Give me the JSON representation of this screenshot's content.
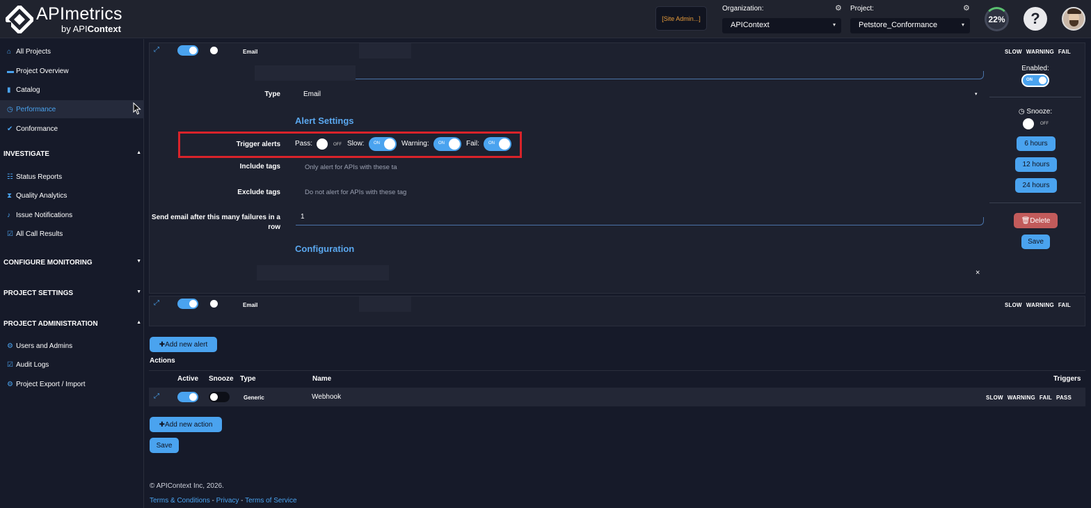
{
  "header": {
    "brand": "APImetrics",
    "brand_sub_prefix": "by API",
    "brand_sub_suffix": "Context",
    "site_admin": "[Site Admin...]",
    "org_label": "Organization:",
    "org_value": "APIContext",
    "project_label": "Project:",
    "project_value": "Petstore_Conformance",
    "progress_percent": "22%",
    "help": "?"
  },
  "sidebar": {
    "items": [
      {
        "label": "All Projects",
        "icon": "home-icon"
      },
      {
        "label": "Project Overview",
        "icon": "folder-icon"
      },
      {
        "label": "Catalog",
        "icon": "book-icon"
      },
      {
        "label": "Performance",
        "icon": "clock-icon"
      },
      {
        "label": "Conformance",
        "icon": "check-icon"
      }
    ],
    "investigate": {
      "heading": "INVESTIGATE",
      "items": [
        {
          "label": "Status Reports",
          "icon": "list-icon"
        },
        {
          "label": "Quality Analytics",
          "icon": "hourglass-icon"
        },
        {
          "label": "Issue Notifications",
          "icon": "bell-icon"
        },
        {
          "label": "All Call Results",
          "icon": "check-square-icon"
        }
      ]
    },
    "configure_monitoring": "CONFIGURE MONITORING",
    "project_settings": "PROJECT SETTINGS",
    "project_admin": {
      "heading": "PROJECT ADMINISTRATION",
      "items": [
        {
          "label": "Users and Admins",
          "icon": "gear-icon"
        },
        {
          "label": "Audit Logs",
          "icon": "check-square-icon"
        },
        {
          "label": "Project Export / Import",
          "icon": "gear-icon"
        }
      ]
    }
  },
  "alert1": {
    "type_pill": "Email",
    "triggers": [
      "SLOW",
      "WARNING",
      "FAIL"
    ],
    "type_label": "Type",
    "type_value": "Email",
    "alert_settings_title": "Alert Settings",
    "trigger_label": "Trigger alerts",
    "pass_label": "Pass:",
    "slow_label": "Slow:",
    "warning_label": "Warning:",
    "fail_label": "Fail:",
    "on_text": "ON",
    "off_text": "OFF",
    "include_label": "Include tags",
    "include_placeholder": "Only alert for APIs with these ta",
    "exclude_label": "Exclude tags",
    "exclude_placeholder": "Do not alert for APIs with these tag",
    "failures_label": "Send email after this many failures in a row",
    "failures_value": "1",
    "configuration_title": "Configuration",
    "clear_x": "×",
    "enabled_label": "Enabled:",
    "snooze_label": "Snooze:",
    "snooze_options": [
      "6 hours",
      "12 hours",
      "24 hours"
    ],
    "delete_label": "Delete",
    "save_label": "Save"
  },
  "alert2": {
    "type_pill": "Email",
    "triggers": [
      "SLOW",
      "WARNING",
      "FAIL"
    ]
  },
  "add_alert": "Add new alert",
  "actions": {
    "title": "Actions",
    "headers": {
      "active": "Active",
      "snooze": "Snooze",
      "type": "Type",
      "name": "Name",
      "triggers": "Triggers"
    },
    "row": {
      "type": "Generic",
      "name": "Webhook",
      "triggers": [
        "SLOW",
        "WARNING",
        "FAIL",
        "PASS"
      ]
    }
  },
  "add_action": "Add new action",
  "save": "Save",
  "footer": {
    "copyright": "© APIContext Inc, 2026.",
    "terms": "Terms & Conditions",
    "privacy": "Privacy",
    "tos": "Terms of Service",
    "sep": " - "
  },
  "colors": {
    "accent": "#4aa3ef",
    "background": "#161a29",
    "panel": "#1d212f",
    "highlight": "#d9232a",
    "danger": "#c25b5b"
  }
}
